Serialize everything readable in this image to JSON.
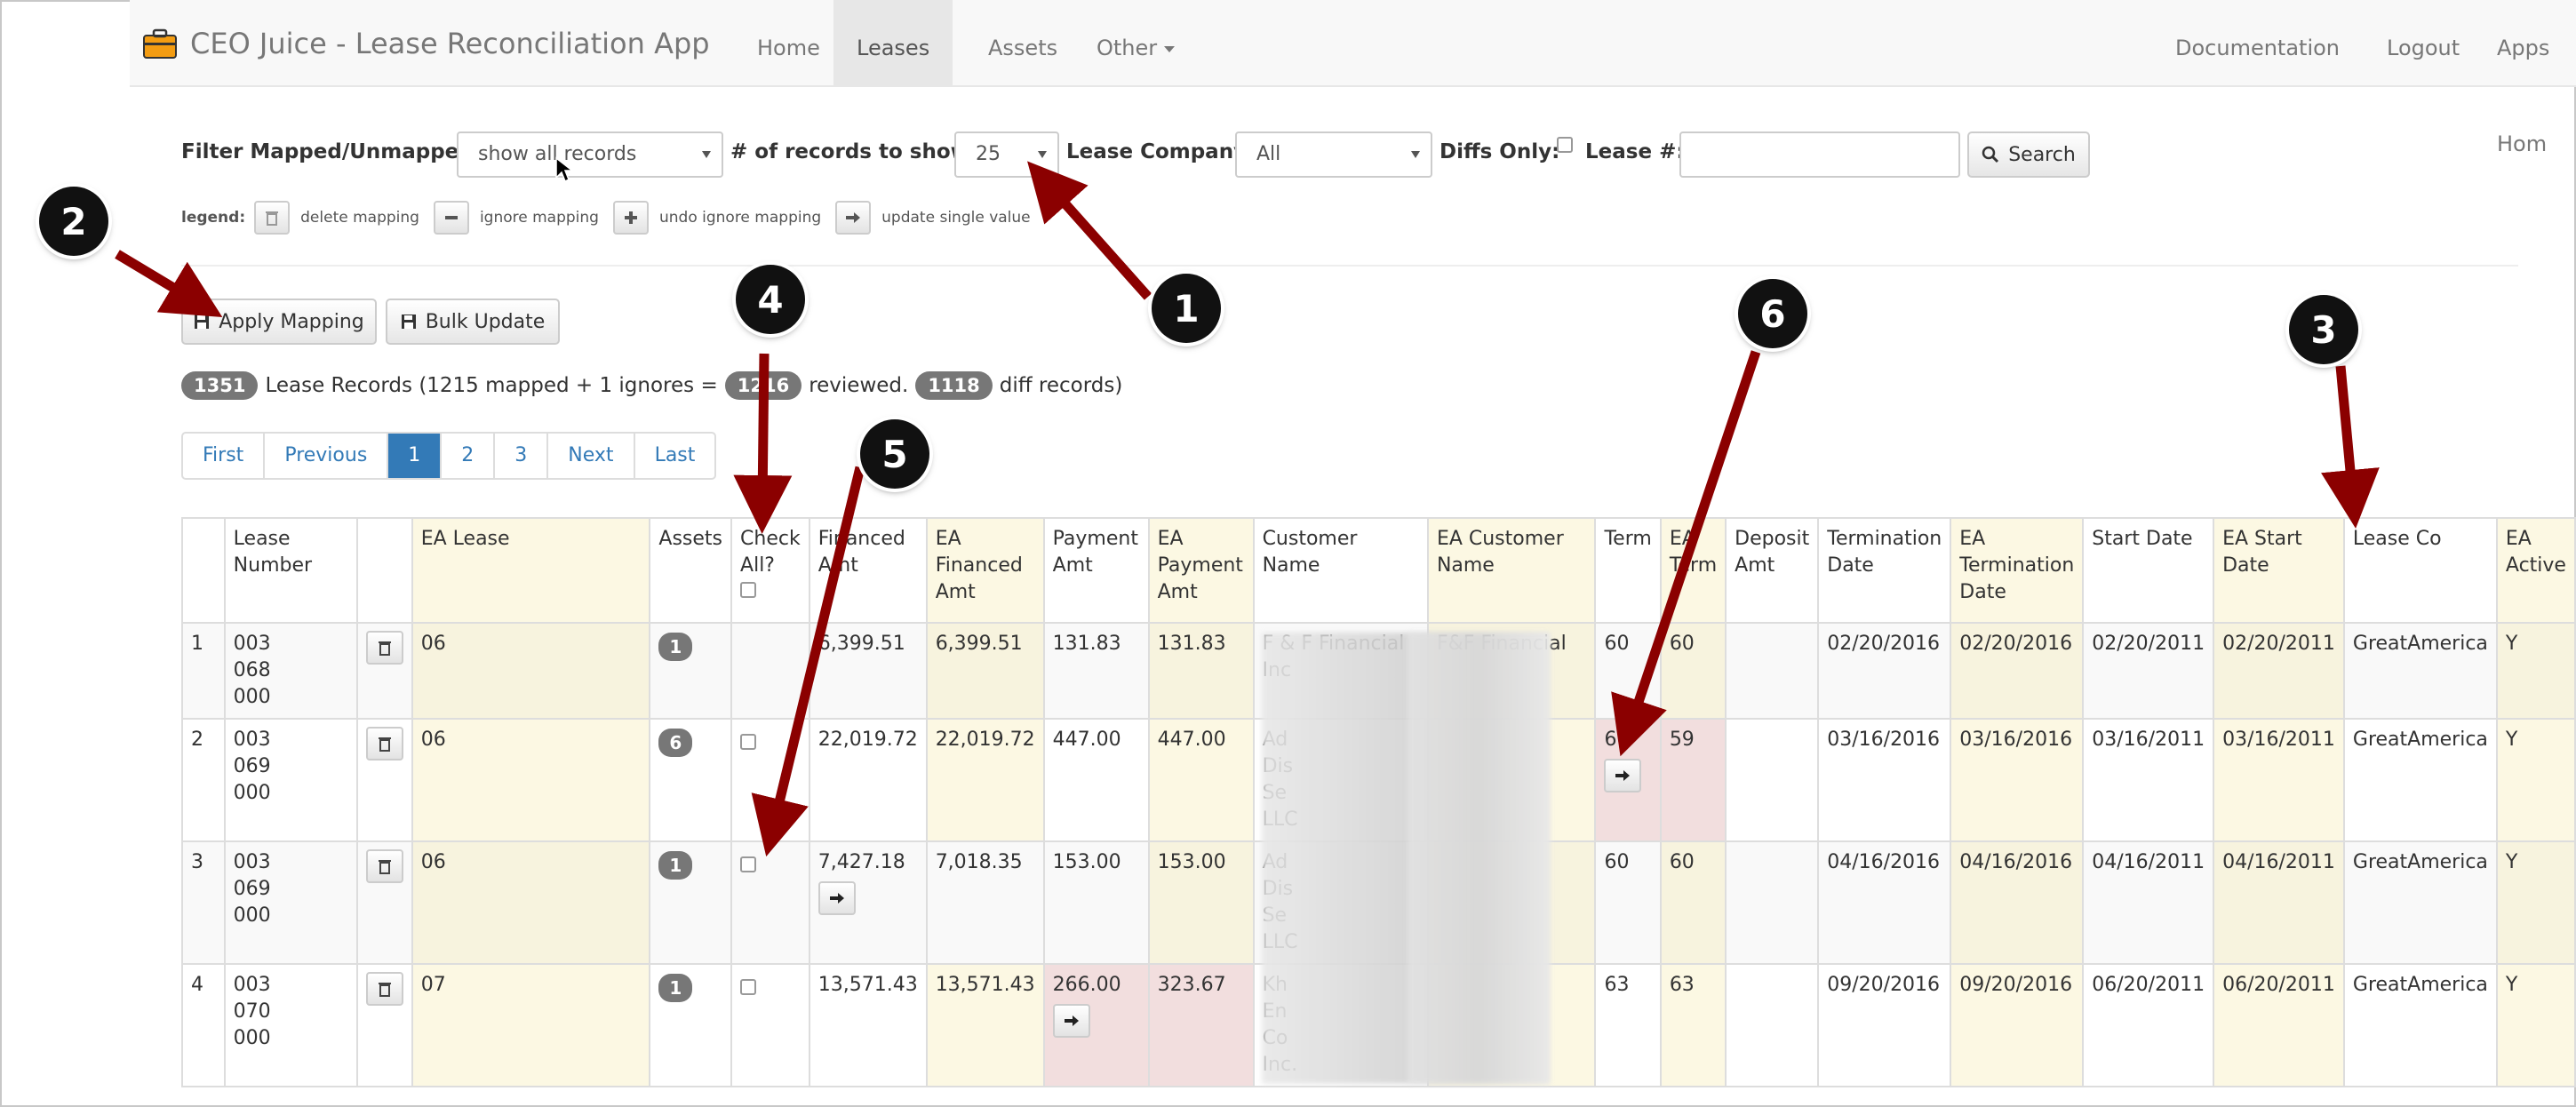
{
  "app": {
    "title": "CEO Juice - Lease Reconciliation App",
    "nav": [
      "Home",
      "Leases",
      "Assets",
      "Other"
    ],
    "nav_right": [
      "Documentation",
      "Logout",
      "Apps Hom"
    ]
  },
  "filters": {
    "mapped_label": "Filter Mapped/Unmapped",
    "mapped_value": "show all records",
    "records_label": "# of records to show",
    "records_value": "25",
    "company_label": "Lease Company",
    "company_value": "All",
    "diffs_label": "Diffs Only:",
    "lease_label": "Lease #:",
    "lease_value": "",
    "search_label": "Search"
  },
  "legend": {
    "label": "legend:",
    "items": [
      "delete mapping",
      "ignore mapping",
      "undo ignore mapping",
      "update single value"
    ]
  },
  "actions": {
    "apply": "Apply Mapping",
    "bulk": "Bulk Update"
  },
  "summary": {
    "total": "1351",
    "text1": "Lease Records (1215 mapped + 1 ignores =",
    "reviewed": "1216",
    "text2": "reviewed.",
    "diff": "1118",
    "text3": "diff records)"
  },
  "pager": [
    "First",
    "Previous",
    "1",
    "2",
    "3",
    "Next",
    "Last"
  ],
  "table": {
    "headers": {
      "num": "",
      "lease_number": "Lease Number",
      "del": "",
      "ea_lease": "EA Lease",
      "assets": "Assets",
      "check_all": "Check All?",
      "fin": "Financed Amt",
      "ea_fin": "EA Financed Amt",
      "pay": "Payment Amt",
      "ea_pay": "EA Payment Amt",
      "cust": "Customer Name",
      "ea_cust": "EA Customer Name",
      "term": "Term",
      "ea_term": "EA Term",
      "deposit": "Deposit Amt",
      "term_date": "Termination Date",
      "ea_term_date": "EA Termination Date",
      "start": "Start Date",
      "ea_start": "EA Start Date",
      "lease_co": "Lease Co",
      "ea_active": "EA Active"
    },
    "rows": [
      {
        "num": "1",
        "lease": "003\n068\n000",
        "ea_lease": "06",
        "assets": "1",
        "fin": "6,399.51",
        "ea_fin": "6,399.51",
        "pay": "131.83",
        "ea_pay": "131.83",
        "cust": "F & F Financial Inc",
        "ea_cust": "F&F Financial",
        "term": "60",
        "ea_term": "60",
        "deposit": "",
        "term_date": "02/20/2016",
        "ea_term_date": "02/20/2016",
        "start": "02/20/2011",
        "ea_start": "02/20/2011",
        "lease_co": "GreatAmerica",
        "ea_active": "Y"
      },
      {
        "num": "2",
        "lease": "003\n069\n000",
        "ea_lease": "06",
        "assets": "6",
        "fin": "22,019.72",
        "ea_fin": "22,019.72",
        "pay": "447.00",
        "ea_pay": "447.00",
        "cust": "Ad\nDis\nSe\nLLC",
        "ea_cust": "",
        "term": "60",
        "ea_term": "59",
        "deposit": "",
        "term_date": "03/16/2016",
        "ea_term_date": "03/16/2016",
        "start": "03/16/2011",
        "ea_start": "03/16/2011",
        "lease_co": "GreatAmerica",
        "ea_active": "Y"
      },
      {
        "num": "3",
        "lease": "003\n069\n000",
        "ea_lease": "06",
        "assets": "1",
        "fin": "7,427.18",
        "ea_fin": "7,018.35",
        "pay": "153.00",
        "ea_pay": "153.00",
        "cust": "Ad\nDis\nSe\nLLC",
        "ea_cust": "",
        "term": "60",
        "ea_term": "60",
        "deposit": "",
        "term_date": "04/16/2016",
        "ea_term_date": "04/16/2016",
        "start": "04/16/2011",
        "ea_start": "04/16/2011",
        "lease_co": "GreatAmerica",
        "ea_active": "Y"
      },
      {
        "num": "4",
        "lease": "003\n070\n000",
        "ea_lease": "07",
        "assets": "1",
        "fin": "13,571.43",
        "ea_fin": "13,571.43",
        "pay": "266.00",
        "ea_pay": "323.67",
        "cust": "Kh\nEn\nCo\nInc.",
        "ea_cust": "",
        "term": "63",
        "ea_term": "63",
        "deposit": "",
        "term_date": "09/20/2016",
        "ea_term_date": "09/20/2016",
        "start": "06/20/2011",
        "ea_start": "06/20/2011",
        "lease_co": "GreatAmerica",
        "ea_active": "Y"
      }
    ]
  },
  "annotations": [
    "1",
    "2",
    "3",
    "4",
    "5",
    "6"
  ],
  "colors": {
    "annotation_arrow": "#8b0000",
    "primary": "#337ab7",
    "diff_cell": "#f2dede",
    "ea_header": "#fcf8e3"
  }
}
